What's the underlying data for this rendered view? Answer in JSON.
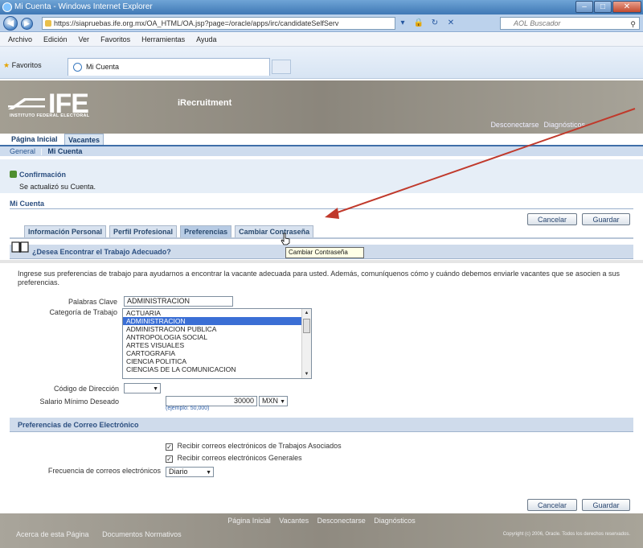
{
  "window": {
    "title": "Mi Cuenta - Windows Internet Explorer",
    "url": "https://siapruebas.ife.org.mx/OA_HTML/OA.jsp?page=/oracle/apps/irc/candidateSelfServ",
    "search_placeholder": "AOL Buscador",
    "controls": {
      "minimize": "–",
      "maximize": "□",
      "close": "✕"
    }
  },
  "menu": [
    "Archivo",
    "Edición",
    "Ver",
    "Favoritos",
    "Herramientas",
    "Ayuda"
  ],
  "favorites": {
    "label": "Favoritos",
    "tab": "Mi Cuenta"
  },
  "header": {
    "logo": "IFE",
    "logo_sub": "INSTITUTO FEDERAL ELECTORAL",
    "app_name": "iRecruitment",
    "links": [
      "Desconectarse",
      "Diagnósticos"
    ]
  },
  "tabs": {
    "home": "Página Inicial",
    "vacancies": "Vacantes"
  },
  "subnav": {
    "general": "General",
    "separator": "|",
    "account": "Mi Cuenta"
  },
  "confirmation": {
    "title": "Confirmación",
    "message": "Se actualizó su Cuenta."
  },
  "page_title": "Mi Cuenta",
  "buttons": {
    "cancel": "Cancelar",
    "save": "Guardar"
  },
  "subtabs": [
    "Información Personal",
    "Perfil Profesional",
    "Preferencias",
    "Cambiar Contraseña"
  ],
  "tooltip": "Cambiar Contraseña",
  "section1": {
    "title": "¿Desea Encontrar el Trabajo Adecuado?"
  },
  "intro": "Ingrese sus preferencias de trabajo para ayudarnos a encontrar la vacante adecuada para usted. Además, comuníquenos cómo y cuándo debemos enviarle vacantes que se asocien a sus preferencias.",
  "form": {
    "keywords_label": "Palabras Clave",
    "keywords_value": "ADMINISTRACION",
    "category_label": "Categoría de Trabajo",
    "categories": [
      "ACTUARIA",
      "ADMINISTRACION",
      "ADMINISTRACION PUBLICA",
      "ANTROPOLOGIA SOCIAL",
      "ARTES VISUALES",
      "CARTOGRAFIA",
      "CIENCIA POLITICA",
      "CIENCIAS DE LA COMUNICACION"
    ],
    "selected_category": "ADMINISTRACION",
    "address_code_label": "Código de Dirección",
    "salary_label": "Salario Mínimo Deseado",
    "salary_value": "30000",
    "currency": "MXN",
    "salary_hint": "(ejemplo: 50,000)"
  },
  "section2": {
    "title": "Preferencias de Correo Electrónico"
  },
  "email": {
    "check1": "Recibir correos electrónicos de Trabajos Asociados",
    "check2": "Recibir correos electrónicos Generales",
    "freq_label": "Frecuencia de correos electrónicos",
    "freq_value": "Diario"
  },
  "footer": {
    "links": [
      "Página Inicial",
      "Vacantes",
      "Desconectarse",
      "Diagnósticos"
    ],
    "left": [
      "Acerca de esta Página",
      "Documentos Normativos"
    ],
    "copyright": "Copyright (c) 2006, Oracle. Todos los derechos reservados."
  },
  "colors": {
    "annotation_arrow": "#c0392b",
    "accent": "#2c4f80",
    "selection": "#3b6fd5"
  }
}
